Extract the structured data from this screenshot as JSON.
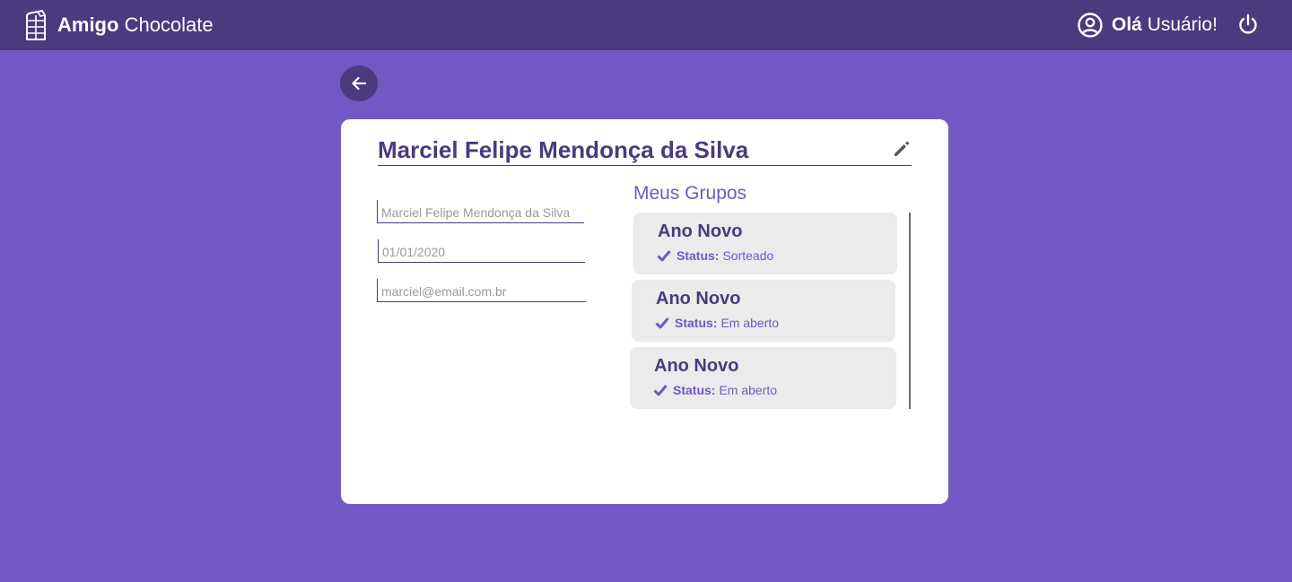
{
  "header": {
    "brand_bold": "Amigo",
    "brand_light": "Chocolate",
    "greeting_bold": "Olá",
    "greeting_rest": "Usuário!"
  },
  "profile": {
    "name": "Marciel Felipe Mendonça da Silva",
    "fields": {
      "name_placeholder": "Marciel Felipe Mendonça da Silva",
      "date_placeholder": "01/01/2020",
      "email_placeholder": "marciel@email.com.br"
    }
  },
  "groups": {
    "title": "Meus Grupos",
    "items": [
      {
        "name": "Ano Novo",
        "status_label": "Status:",
        "status_value": "Sorteado"
      },
      {
        "name": "Ano Novo",
        "status_label": "Status:",
        "status_value": "Em aberto"
      },
      {
        "name": "Ano Novo",
        "status_label": "Status:",
        "status_value": "Em aberto"
      }
    ]
  },
  "icons": {
    "logo": "chocolate-bar-icon",
    "user": "user-circle-icon",
    "power": "power-icon",
    "back": "arrow-left-icon",
    "edit": "pencil-icon",
    "check": "check-icon"
  },
  "colors": {
    "background": "#7258c2",
    "header": "#4a3a7e",
    "accent": "#7258c2",
    "card": "#ffffff",
    "group_card": "#ebebeb"
  }
}
